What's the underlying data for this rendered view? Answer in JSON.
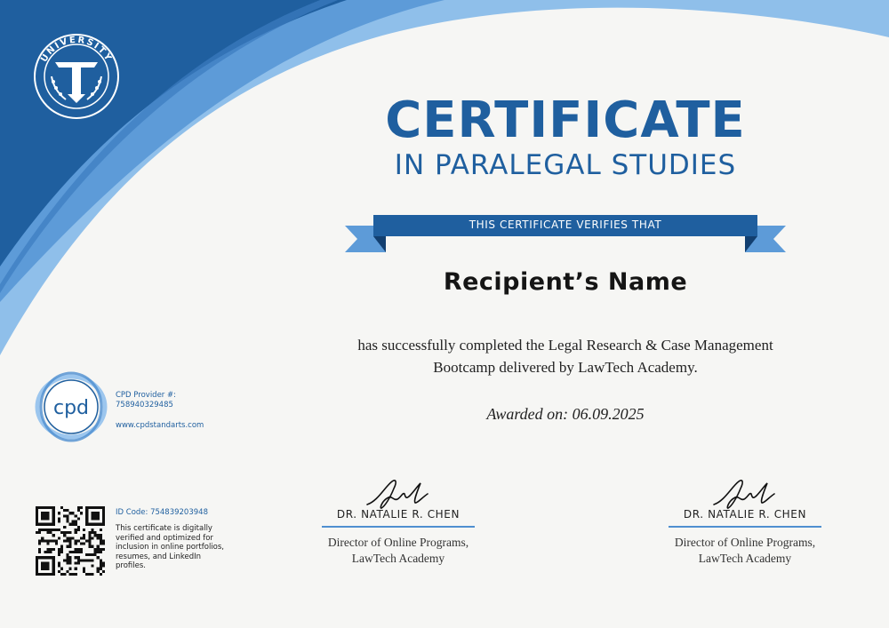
{
  "title": "CERTIFICATE",
  "subtitle": "IN PARALEGAL STUDIES",
  "ribbon_text": "THIS CERTIFICATE VERIFIES THAT",
  "recipient": "Recipient’s Name",
  "description_line1": "has successfully completed the Legal Research & Case Management",
  "description_line2": "Bootcamp delivered by LawTech Academy.",
  "awarded_label": "Awarded on:",
  "awarded_date": "06.09.2025",
  "emblem": {
    "ring_text": "UNIVERSITY",
    "icon": "university-emblem-icon"
  },
  "cpd": {
    "logo_text": "cpd",
    "provider_label": "CPD Provider #:",
    "provider_number": "758940329485",
    "website": "www.cpdstandarts.com"
  },
  "verification": {
    "id_code": "ID Code: 754839203948",
    "note": "This certificate is digitally verified and optimized for inclusion in online portfolios, resumes, and LinkedIn profiles."
  },
  "signatories": [
    {
      "name": "DR. NATALIE R. CHEN",
      "role_line1": "Director of Online Programs,",
      "role_line2": "LawTech Academy"
    },
    {
      "name": "DR. NATALIE R. CHEN",
      "role_line1": "Director of Online Programs,",
      "role_line2": "LawTech Academy"
    }
  ],
  "colors": {
    "primary": "#1f5f9f",
    "accent": "#4f8fd0",
    "light": "#9cc6ee",
    "background": "#f6f6f4"
  }
}
